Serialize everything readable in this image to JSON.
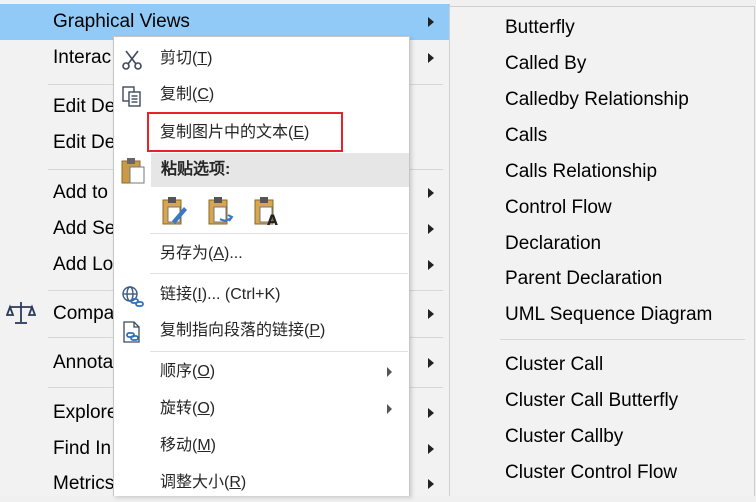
{
  "base_menu": {
    "items": [
      {
        "label": "Graphical Views"
      },
      {
        "label": "Interac"
      },
      {
        "label": "Edit De"
      },
      {
        "label": "Edit De"
      },
      {
        "label": "Add to"
      },
      {
        "label": "Add Se"
      },
      {
        "label": "Add Lo"
      },
      {
        "label": "Compa"
      },
      {
        "label": "Annota"
      },
      {
        "label": "Explore"
      },
      {
        "label": "Find In"
      },
      {
        "label": "Metrics"
      }
    ]
  },
  "submenu": {
    "items": [
      "Butterfly",
      "Called By",
      "Calledby Relationship",
      "Calls",
      "Calls Relationship",
      "Control Flow",
      "Declaration",
      "Parent Declaration",
      "UML Sequence Diagram",
      "Cluster Call",
      "Cluster Call Butterfly",
      "Cluster Callby",
      "Cluster Control Flow"
    ]
  },
  "context_menu": {
    "cut": {
      "text": "剪切(",
      "key": "T",
      "end": ")"
    },
    "copy": {
      "text": "复制(",
      "key": "C",
      "end": ")"
    },
    "copy_text_from_image": {
      "text": "复制图片中的文本(",
      "key": "E",
      "end": ")"
    },
    "paste_options_label": "粘贴选项:",
    "save_as": {
      "text": "另存为(",
      "key": "A",
      "end": ")..."
    },
    "link": {
      "text": "链接(",
      "key": "I",
      "end": ")...  (Ctrl+K)"
    },
    "copy_link_to_paragraph": {
      "text": "复制指向段落的链接(",
      "key": "P",
      "end": ")"
    },
    "order": {
      "text": "顺序(",
      "key": "O",
      "end": ")"
    },
    "rotate": {
      "text": "旋转(",
      "key": "O",
      "end": ")"
    },
    "move": {
      "text": "移动(",
      "key": "M",
      "end": ")"
    },
    "resize": {
      "text": "调整大小(",
      "key": "R",
      "end": ")"
    }
  },
  "colors": {
    "highlight": "#91c9f7",
    "red_box": "#e8222a",
    "menu_bg": "#f2f2f2",
    "context_bg": "#ffffff"
  }
}
